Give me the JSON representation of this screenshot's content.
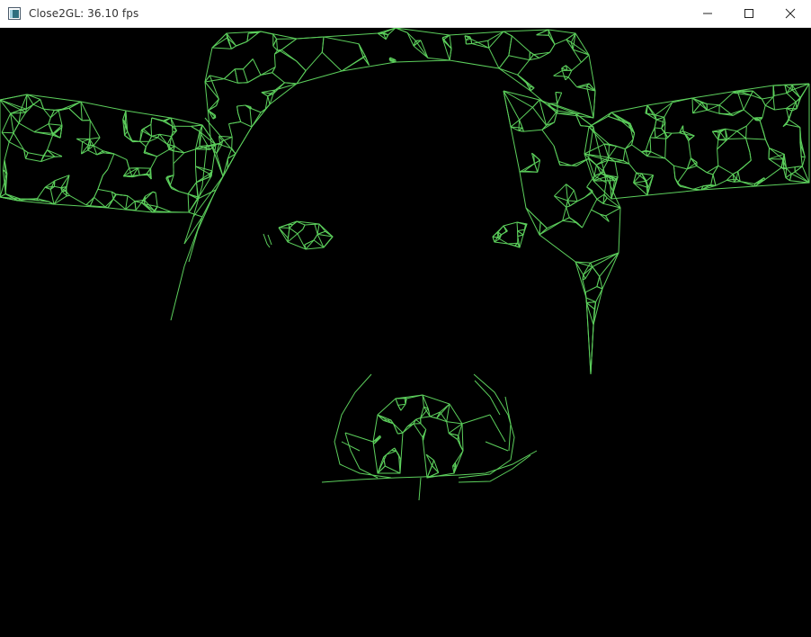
{
  "window": {
    "title": "Close2GL: 36.10 fps",
    "icon": "app-window-icon",
    "controls": {
      "minimize_icon": "minimize-icon",
      "maximize_icon": "maximize-icon",
      "close_icon": "close-icon"
    }
  },
  "render": {
    "background_color": "#000000",
    "wire_color": "#5ccf5c",
    "mode": "wireframe"
  }
}
